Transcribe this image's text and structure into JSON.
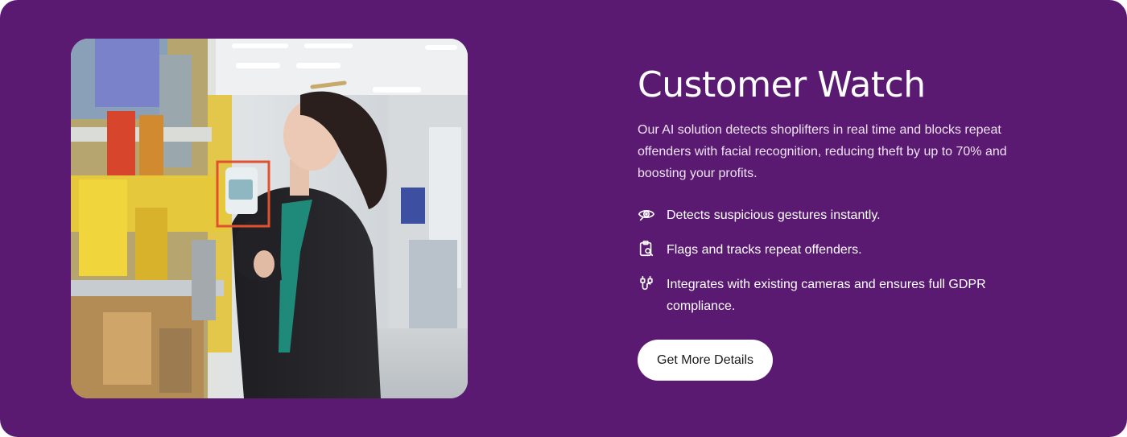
{
  "section": {
    "title": "Customer Watch",
    "description": "Our AI solution detects shoplifters in real time and blocks repeat offenders with facial recognition, reducing theft by up to 70% and boosting your profits.",
    "features": [
      {
        "icon": "eye-scan-icon",
        "text": "Detects suspicious gestures instantly."
      },
      {
        "icon": "clipboard-search-icon",
        "text": "Flags and tracks repeat offenders."
      },
      {
        "icon": "cable-connector-icon",
        "text": "Integrates with existing cameras and ensures full GDPR compliance."
      }
    ],
    "cta_label": "Get More Details"
  },
  "photo": {
    "subject": "Shopper in supermarket aisle holding a product, highlighted by a detection box"
  },
  "colors": {
    "background": "#5a1a72",
    "text": "#ffffff",
    "button_bg": "#ffffff",
    "button_text": "#1a1a1a",
    "detection_box": "#e2512d"
  }
}
